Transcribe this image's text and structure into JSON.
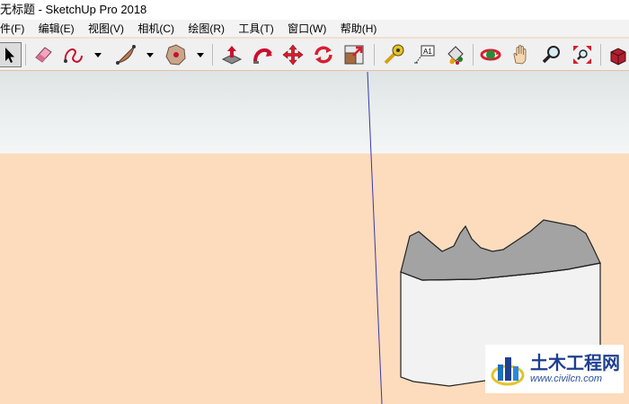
{
  "window": {
    "title": "无标题 - SketchUp Pro 2018"
  },
  "menu": [
    "件(F)",
    "编辑(E)",
    "视图(V)",
    "相机(C)",
    "绘图(R)",
    "工具(T)",
    "窗口(W)",
    "帮助(H)"
  ],
  "toolbar": {
    "tools": [
      {
        "name": "select-tool",
        "icon": "arrow-icon",
        "selected": true
      },
      {
        "name": "eraser-tool",
        "icon": "eraser-icon"
      },
      {
        "name": "freehand-tool",
        "icon": "freehand-icon"
      },
      {
        "name": "arc-tool",
        "icon": "arc-icon"
      },
      {
        "name": "polygon-tool",
        "icon": "polygon-icon"
      },
      {
        "name": "push-pull-tool",
        "icon": "push-pull-icon"
      },
      {
        "name": "follow-me-tool",
        "icon": "follow-me-icon"
      },
      {
        "name": "move-tool",
        "icon": "move-icon"
      },
      {
        "name": "rotate-tool",
        "icon": "rotate-icon"
      },
      {
        "name": "scale-tool",
        "icon": "scale-icon"
      },
      {
        "name": "tape-measure-tool",
        "icon": "tape-measure-icon"
      },
      {
        "name": "text-tool",
        "icon": "text-icon",
        "label": "A1"
      },
      {
        "name": "paint-bucket-tool",
        "icon": "paint-bucket-icon"
      },
      {
        "name": "orbit-tool",
        "icon": "orbit-icon"
      },
      {
        "name": "pan-tool",
        "icon": "hand-icon"
      },
      {
        "name": "zoom-tool",
        "icon": "magnifier-icon"
      },
      {
        "name": "zoom-extents-tool",
        "icon": "zoom-extents-icon"
      },
      {
        "name": "warehouse-tool",
        "icon": "warehouse-icon"
      }
    ]
  },
  "watermark": {
    "title": "土木工程网",
    "url": "www.civilcn.com"
  },
  "colors": {
    "sky": "#e6eaeb",
    "ground": "#fcdcbd",
    "top_face": "#a3a3a3",
    "side_face": "#f2f2f2",
    "blue_axis": "#3838a8",
    "watermark_blue": "#1f3f8f"
  }
}
